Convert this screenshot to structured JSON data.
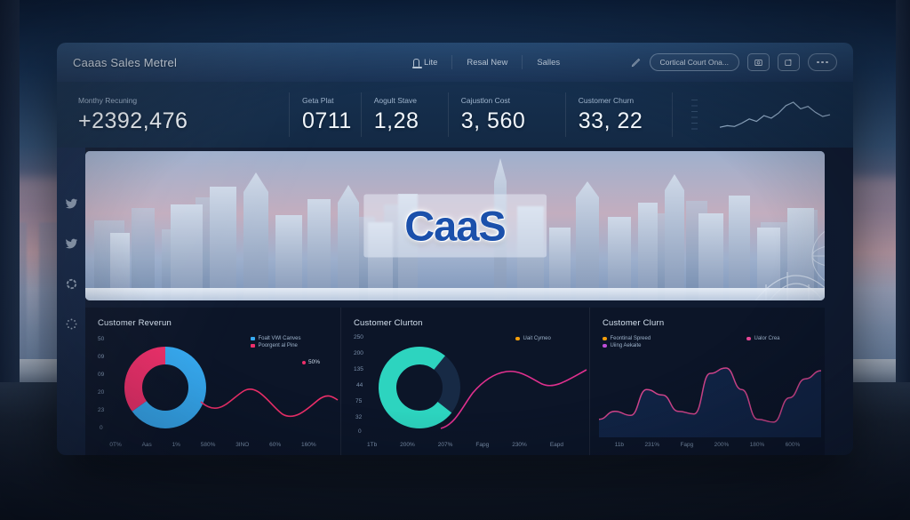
{
  "header": {
    "title": "Caaas Sales Metrel",
    "nav": [
      {
        "label": "Lite",
        "icon": "bell-icon"
      },
      {
        "label": "Resal New",
        "icon": ""
      },
      {
        "label": "Salles",
        "icon": ""
      }
    ],
    "edit_icon": "pencil-icon",
    "chip_label": "Cortical Court Ona...",
    "btn1_icon": "image-icon",
    "btn2_icon": "export-icon",
    "more_label": "more-options"
  },
  "kpis": [
    {
      "label": "Monthy Recuning",
      "value": "+2392,476",
      "prefix": "+",
      "number": "2392,476"
    },
    {
      "label": "Geta Plat",
      "value": "0711",
      "prefix": "",
      "number": "0711"
    },
    {
      "label": "Aogult Stave",
      "value": "1,28",
      "prefix": "",
      "number": "1,28"
    },
    {
      "label": "Cajustlon Cost",
      "value": "3, 560",
      "prefix": "",
      "number": "3, 560"
    },
    {
      "label": "Customer Churn",
      "value": "33, 22",
      "prefix": "",
      "number": "33, 22"
    }
  ],
  "sparkline": {
    "name": "kpi-sparkline",
    "points": [
      4,
      6,
      5,
      9,
      14,
      11,
      18,
      15,
      21,
      30,
      34,
      26,
      29,
      22,
      17,
      19
    ]
  },
  "hero": {
    "word": "CaaS",
    "color": "#1b50ab",
    "alt": "city skyline banner"
  },
  "sidebar": {
    "items": [
      {
        "name": "bird-icon"
      },
      {
        "name": "bird-icon"
      },
      {
        "name": "ring-icon"
      },
      {
        "name": "dotted-circle-icon"
      }
    ]
  },
  "chart_data": [
    {
      "type": "pie",
      "panel": "customer-revenue",
      "title": "Customer Reverun",
      "categories": [
        "Foalt VWl Canves",
        "Poorgent al Pine"
      ],
      "values": [
        65,
        35
      ],
      "colors": [
        "#36a9f0",
        "#ef2f6a"
      ],
      "legend_position": "top-right",
      "annotation": "50%",
      "ylabel": "",
      "xlabel": "",
      "ytick_labels": [
        "50",
        "09",
        "09",
        "20",
        "23",
        "0"
      ],
      "xtick_labels": [
        "0T%",
        "Aas",
        "1%",
        "580%",
        "3INO",
        "60%",
        "160%"
      ],
      "overlay_line": {
        "name": "trend",
        "color": "#ef2f6a",
        "values": [
          28,
          34,
          30,
          22,
          16,
          13,
          18,
          24,
          21,
          17
        ]
      }
    },
    {
      "type": "pie",
      "panel": "customer-churn-mid",
      "title": "Customer Clurton",
      "categories": [
        "Uait Cymeo"
      ],
      "values": [
        75,
        25
      ],
      "colors": [
        "#2dd4bf",
        "#172a45"
      ],
      "legend_position": "top-right",
      "ytick_labels": [
        "250",
        "200",
        "135",
        "44",
        "75",
        "32",
        "0"
      ],
      "xtick_labels": [
        "1Tb",
        "200%",
        "207%",
        "Fapg",
        "230%",
        "Eapd"
      ],
      "overlay_line": {
        "name": "trend",
        "color": "#e0308e",
        "values": [
          6,
          14,
          30,
          40,
          34,
          30,
          38,
          44,
          41,
          36
        ]
      }
    },
    {
      "type": "area",
      "panel": "customer-churn-right",
      "title": "Customer Clurn",
      "series": [
        {
          "name": "Feontinal Spreed",
          "color": "#f59e0b"
        },
        {
          "name": "Uiing Aekaite",
          "color": "#c04fd8"
        },
        {
          "name": "Ualor Crea",
          "color": "#ec4899"
        }
      ],
      "values": [
        8,
        14,
        11,
        30,
        26,
        14,
        12,
        42,
        46,
        30,
        8,
        6,
        24,
        38,
        44
      ],
      "line_color": "#d6468f",
      "fill_color": "#16325e",
      "legend_position": "top",
      "xtick_labels": [
        "11b",
        "231%",
        "Fapg",
        "200%",
        "180%",
        "600%"
      ]
    }
  ]
}
